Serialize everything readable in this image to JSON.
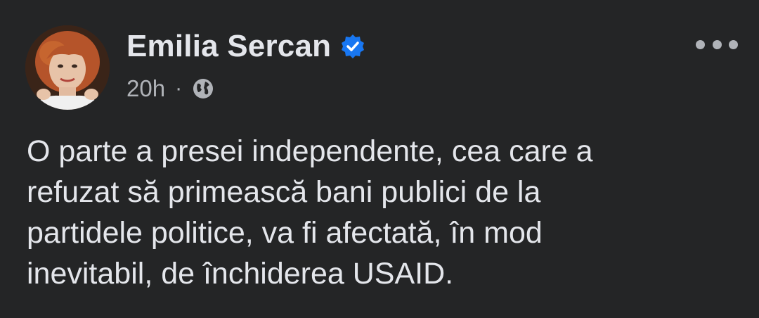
{
  "post": {
    "author": {
      "name": "Emilia Sercan",
      "verified_icon": "verified-badge-icon",
      "avatar": "profile-photo"
    },
    "meta": {
      "time": "20h",
      "separator": "·",
      "audience_icon": "globe-icon"
    },
    "more_icon": "more-options-icon",
    "text_lines": [
      "O parte a presei independente, cea care a",
      "refuzat să primească bani publici de la",
      "partidele politice, va fi afectată, în mod",
      "inevitabil, de închiderea USAID."
    ]
  },
  "colors": {
    "background": "#242526",
    "primary_text": "#e4e6eb",
    "secondary_text": "#b0b3b8",
    "verified_blue": "#1877f2"
  }
}
